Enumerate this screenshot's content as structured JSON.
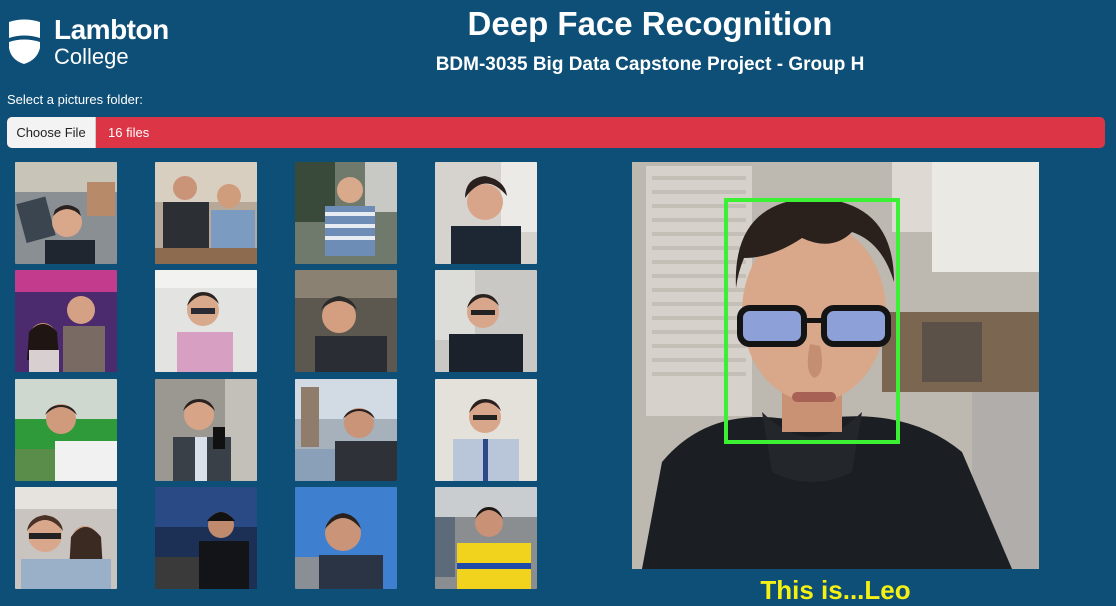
{
  "brand": {
    "name": "Lambton",
    "sub": "College",
    "logo_icon": "shield-logo-icon"
  },
  "header": {
    "title": "Deep Face Recognition",
    "subtitle": "BDM-3035 Big Data Capstone Project - Group H"
  },
  "folder_picker": {
    "label": "Select a pictures folder:",
    "button_label": "Choose File",
    "file_count": "16 files",
    "bar_color": "#dc3545"
  },
  "gallery": {
    "count": 16
  },
  "result": {
    "text": "This is...Leo",
    "face_box_color": "#3cf034",
    "text_color": "#f4f014"
  },
  "colors": {
    "background": "#0e4f77"
  }
}
